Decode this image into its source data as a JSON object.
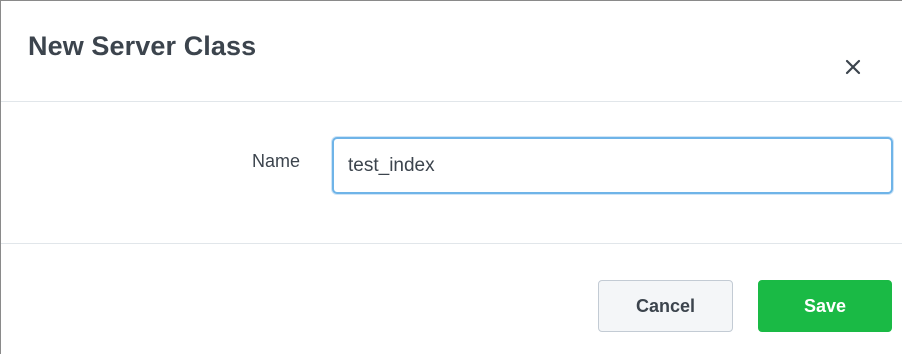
{
  "dialog": {
    "title": "New Server Class",
    "close_icon": "close-icon"
  },
  "form": {
    "name_label": "Name",
    "name_value": "test_index"
  },
  "footer": {
    "cancel_label": "Cancel",
    "save_label": "Save"
  },
  "colors": {
    "save_button": "#1aba45",
    "input_focus_border": "#6fb4e8",
    "title_text": "#3c444d"
  }
}
